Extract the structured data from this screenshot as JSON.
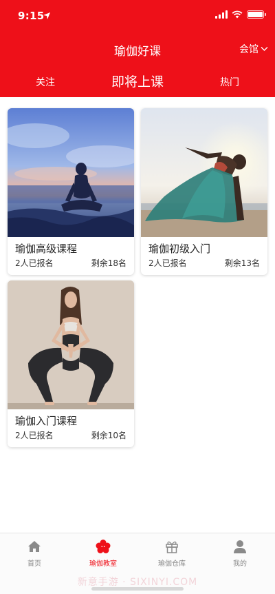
{
  "status_bar": {
    "time": "9:15"
  },
  "nav": {
    "title": "瑜伽好课",
    "venue": "会馆"
  },
  "tabs": [
    {
      "label": "关注",
      "active": false
    },
    {
      "label": "即将上课",
      "active": true
    },
    {
      "label": "热门",
      "active": false
    }
  ],
  "courses": [
    {
      "title": "瑜伽高级课程",
      "enrolled": "2人已报名",
      "remaining": "剩余18名"
    },
    {
      "title": "瑜伽初级入门",
      "enrolled": "2人已报名",
      "remaining": "剩余13名"
    },
    {
      "title": "瑜伽入门课程",
      "enrolled": "2人已报名",
      "remaining": "剩余10名"
    }
  ],
  "bottom_nav": [
    {
      "label": "首页",
      "icon": "home-icon",
      "active": false
    },
    {
      "label": "瑜伽教室",
      "icon": "yoga-room-icon",
      "active": true
    },
    {
      "label": "瑜伽仓库",
      "icon": "gift-box-icon",
      "active": false
    },
    {
      "label": "我的",
      "icon": "user-icon",
      "active": false
    }
  ],
  "watermark": "新意手游 · SIXINYI.COM",
  "colors": {
    "brand": "#ee1019",
    "tab_inactive": "#8a8a8a",
    "background": "#ffffff"
  }
}
